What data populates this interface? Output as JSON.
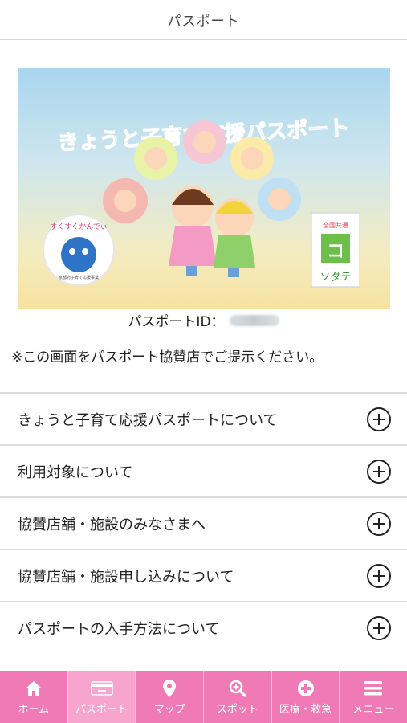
{
  "header": {
    "title": "パスポート"
  },
  "card": {
    "banner_title": "きょうと子育て応援パスポート",
    "badge_left_text": "すくすくかんでぃ",
    "badge_left_small": "京都府子育て応援事業",
    "badge_right_top": "全国共通",
    "badge_right_bottom": "ソダテ"
  },
  "passport": {
    "id_label": "パスポートID："
  },
  "notice": "※この画面をパスポート協賛店でご提示ください。",
  "accordion": [
    {
      "label": "きょうと子育て応援パスポートについて"
    },
    {
      "label": "利用対象について"
    },
    {
      "label": "協賛店舗・施設のみなさまへ"
    },
    {
      "label": "協賛店舗・施設申し込みについて"
    },
    {
      "label": "パスポートの入手方法について"
    }
  ],
  "tabbar": {
    "active": "passport",
    "color": "#f07ab5",
    "active_color": "#f7a5cd",
    "items": [
      {
        "label": "ホーム",
        "icon": "home-icon"
      },
      {
        "label": "パスポート",
        "icon": "passport-card-icon"
      },
      {
        "label": "マップ",
        "icon": "map-pin-icon"
      },
      {
        "label": "スポット",
        "icon": "search-icon"
      },
      {
        "label": "医療・救急",
        "icon": "medical-cross-icon"
      },
      {
        "label": "メニュー",
        "icon": "hamburger-menu-icon"
      }
    ]
  }
}
